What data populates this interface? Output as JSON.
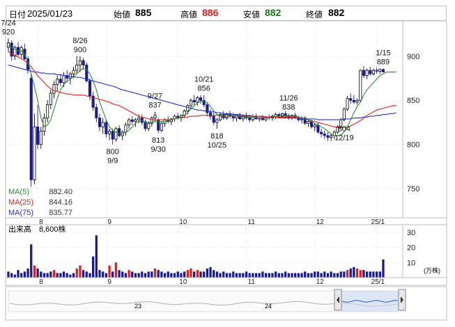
{
  "header": {
    "date_label": "日付",
    "date": "2025/01/23",
    "open_label": "始値",
    "open": "885",
    "high_label": "高値",
    "high": "886",
    "low_label": "安値",
    "low": "882",
    "close_label": "終値",
    "close": "882"
  },
  "colors": {
    "up": "#000000",
    "down": "#1a1a8c",
    "ma5": "#2e8b2e",
    "ma25": "#e02020",
    "ma75": "#2030c8",
    "volume_normal": "#1a1a8c",
    "volume_high": "#e02020",
    "high_text": "#e02020",
    "low_text": "#1a7a1a"
  },
  "chart_data": [
    {
      "type": "candlestick",
      "y_axis": {
        "range": [
          717,
          940
        ],
        "ticks": [
          "900",
          "850",
          "800",
          "750"
        ]
      },
      "x_axis": {
        "ticks": [
          "8",
          "9",
          "10",
          "11",
          "12",
          "25/1"
        ]
      },
      "legend": [
        {
          "label": "MA(5)",
          "value": "882.40"
        },
        {
          "label": "MA(25)",
          "value": "844.16"
        },
        {
          "label": "MA(75)",
          "value": "835.77"
        }
      ],
      "annotations": [
        {
          "date": "7/24",
          "price": "920",
          "idx": 0
        },
        {
          "date": "8/26",
          "price": "900",
          "idx": 22
        },
        {
          "date": "9/9",
          "price": "800",
          "idx": 32
        },
        {
          "date": "9/27",
          "price": "837",
          "idx": 45
        },
        {
          "date": "9/30",
          "price": "813",
          "idx": 46
        },
        {
          "date": "10/21",
          "price": "856",
          "idx": 60
        },
        {
          "date": "10/25",
          "price": "818",
          "idx": 64
        },
        {
          "date": "11/26",
          "price": "838",
          "idx": 86
        },
        {
          "date": "12/19",
          "price": "804",
          "idx": 103
        },
        {
          "date": "1/15",
          "price": "889",
          "idx": 115
        }
      ],
      "ohlc": [
        [
          910,
          920,
          905,
          915
        ],
        [
          915,
          918,
          895,
          900
        ],
        [
          900,
          912,
          896,
          910
        ],
        [
          910,
          916,
          900,
          902
        ],
        [
          902,
          912,
          898,
          910
        ],
        [
          908,
          914,
          895,
          897
        ],
        [
          897,
          900,
          880,
          885
        ],
        [
          875,
          880,
          745,
          760
        ],
        [
          760,
          835,
          755,
          820
        ],
        [
          820,
          845,
          795,
          800
        ],
        [
          800,
          820,
          795,
          815
        ],
        [
          815,
          835,
          810,
          830
        ],
        [
          830,
          850,
          825,
          845
        ],
        [
          845,
          862,
          840,
          858
        ],
        [
          858,
          872,
          852,
          868
        ],
        [
          868,
          878,
          860,
          874
        ],
        [
          874,
          880,
          866,
          870
        ],
        [
          870,
          882,
          865,
          878
        ],
        [
          878,
          884,
          870,
          875
        ],
        [
          875,
          882,
          868,
          880
        ],
        [
          880,
          888,
          875,
          884
        ],
        [
          884,
          900,
          880,
          890
        ],
        [
          890,
          900,
          882,
          895
        ],
        [
          895,
          898,
          885,
          890
        ],
        [
          890,
          893,
          870,
          872
        ],
        [
          872,
          875,
          850,
          855
        ],
        [
          855,
          860,
          838,
          842
        ],
        [
          842,
          846,
          825,
          830
        ],
        [
          830,
          835,
          815,
          820
        ],
        [
          820,
          830,
          812,
          825
        ],
        [
          825,
          828,
          808,
          812
        ],
        [
          812,
          818,
          805,
          815
        ],
        [
          815,
          818,
          800,
          806
        ],
        [
          806,
          820,
          803,
          818
        ],
        [
          818,
          822,
          808,
          810
        ],
        [
          810,
          816,
          805,
          814
        ],
        [
          814,
          825,
          810,
          822
        ],
        [
          822,
          830,
          818,
          828
        ],
        [
          828,
          832,
          822,
          826
        ],
        [
          826,
          830,
          820,
          828
        ],
        [
          828,
          834,
          824,
          830
        ],
        [
          830,
          834,
          822,
          825
        ],
        [
          825,
          828,
          815,
          818
        ],
        [
          818,
          826,
          815,
          824
        ],
        [
          824,
          832,
          820,
          830
        ],
        [
          830,
          837,
          826,
          833
        ],
        [
          828,
          830,
          813,
          816
        ],
        [
          816,
          826,
          814,
          824
        ],
        [
          824,
          830,
          820,
          828
        ],
        [
          828,
          832,
          824,
          826
        ],
        [
          826,
          830,
          822,
          829
        ],
        [
          829,
          834,
          826,
          832
        ],
        [
          832,
          836,
          828,
          830
        ],
        [
          830,
          834,
          826,
          833
        ],
        [
          833,
          840,
          830,
          838
        ],
        [
          838,
          846,
          834,
          844
        ],
        [
          844,
          852,
          840,
          850
        ],
        [
          850,
          856,
          844,
          848
        ],
        [
          848,
          855,
          844,
          853
        ],
        [
          853,
          856,
          846,
          850
        ],
        [
          850,
          856,
          842,
          845
        ],
        [
          845,
          848,
          832,
          836
        ],
        [
          836,
          840,
          828,
          832
        ],
        [
          832,
          836,
          822,
          825
        ],
        [
          825,
          830,
          818,
          828
        ],
        [
          828,
          836,
          826,
          834
        ],
        [
          834,
          838,
          828,
          830
        ],
        [
          830,
          836,
          828,
          834
        ],
        [
          834,
          838,
          830,
          832
        ],
        [
          832,
          836,
          826,
          830
        ],
        [
          830,
          834,
          826,
          833
        ],
        [
          833,
          836,
          828,
          829
        ],
        [
          829,
          834,
          826,
          832
        ],
        [
          832,
          836,
          828,
          830
        ],
        [
          830,
          833,
          825,
          828
        ],
        [
          828,
          834,
          826,
          832
        ],
        [
          832,
          835,
          828,
          829
        ],
        [
          829,
          832,
          826,
          830
        ],
        [
          830,
          833,
          827,
          828
        ],
        [
          828,
          832,
          826,
          831
        ],
        [
          831,
          834,
          828,
          830
        ],
        [
          830,
          834,
          827,
          832
        ],
        [
          832,
          836,
          829,
          834
        ],
        [
          834,
          836,
          830,
          832
        ],
        [
          832,
          836,
          830,
          835
        ],
        [
          835,
          838,
          830,
          832
        ],
        [
          832,
          835,
          828,
          830
        ],
        [
          830,
          834,
          828,
          833
        ],
        [
          833,
          836,
          829,
          830
        ],
        [
          830,
          833,
          826,
          828
        ],
        [
          828,
          832,
          824,
          830
        ],
        [
          830,
          832,
          822,
          824
        ],
        [
          824,
          828,
          820,
          826
        ],
        [
          826,
          828,
          818,
          820
        ],
        [
          820,
          824,
          815,
          822
        ],
        [
          822,
          825,
          812,
          814
        ],
        [
          814,
          818,
          808,
          812
        ],
        [
          812,
          816,
          806,
          810
        ],
        [
          810,
          814,
          804,
          808
        ],
        [
          808,
          812,
          804,
          810
        ],
        [
          810,
          816,
          806,
          814
        ],
        [
          814,
          822,
          812,
          820
        ],
        [
          820,
          830,
          818,
          828
        ],
        [
          828,
          842,
          826,
          840
        ],
        [
          840,
          855,
          838,
          852
        ],
        [
          852,
          858,
          846,
          850
        ],
        [
          850,
          856,
          846,
          848
        ],
        [
          848,
          852,
          845,
          850
        ],
        [
          850,
          885,
          848,
          884
        ],
        [
          884,
          889,
          875,
          878
        ],
        [
          878,
          886,
          874,
          884
        ],
        [
          884,
          888,
          878,
          880
        ],
        [
          880,
          886,
          878,
          884
        ],
        [
          884,
          887,
          880,
          883
        ],
        [
          883,
          886,
          880,
          885
        ],
        [
          885,
          886,
          882,
          882
        ]
      ],
      "ma5": [
        912,
        910,
        908,
        906,
        906,
        902,
        894,
        880,
        866,
        850,
        830,
        820,
        822,
        828,
        840,
        852,
        862,
        868,
        872,
        874,
        877,
        880,
        884,
        886,
        885,
        880,
        872,
        862,
        848,
        838,
        828,
        820,
        816,
        814,
        812,
        812,
        814,
        816,
        820,
        824,
        826,
        827,
        826,
        825,
        825,
        826,
        826,
        826,
        826,
        827,
        828,
        829,
        830,
        831,
        833,
        836,
        840,
        844,
        847,
        849,
        849,
        847,
        843,
        838,
        834,
        832,
        831,
        831,
        832,
        832,
        832,
        832,
        831,
        831,
        831,
        831,
        830,
        830,
        830,
        830,
        830,
        831,
        832,
        832,
        833,
        833,
        833,
        832,
        832,
        831,
        830,
        829,
        828,
        826,
        824,
        822,
        820,
        818,
        815,
        812,
        810,
        810,
        811,
        814,
        820,
        828,
        836,
        843,
        848,
        856,
        862,
        866,
        870,
        874,
        878,
        880,
        882,
        882,
        882,
        882
      ],
      "ma25": [
        905,
        903,
        901,
        899,
        897,
        895,
        892,
        888,
        883,
        878,
        874,
        870,
        866,
        863,
        861,
        860,
        859,
        858,
        857,
        857,
        856,
        856,
        856,
        856,
        855,
        854,
        853,
        852,
        851,
        850,
        849,
        848,
        846,
        845,
        844,
        842,
        840,
        838,
        836,
        834,
        832,
        831,
        830,
        829,
        828,
        828,
        828,
        828,
        828,
        828,
        828,
        829,
        830,
        830,
        831,
        831,
        832,
        832,
        832,
        833,
        833,
        833,
        833,
        833,
        833,
        833,
        833,
        833,
        833,
        833,
        833,
        833,
        833,
        832,
        832,
        832,
        832,
        832,
        831,
        831,
        831,
        831,
        831,
        831,
        831,
        831,
        831,
        831,
        831,
        830,
        830,
        829,
        828,
        827,
        826,
        825,
        824,
        823,
        822,
        821,
        820,
        819,
        819,
        819,
        820,
        821,
        823,
        825,
        827,
        830,
        833,
        835,
        837,
        839,
        840,
        841,
        842,
        843,
        844,
        844
      ],
      "ma75": [
        890,
        889,
        888,
        887,
        886,
        885,
        884,
        883,
        882,
        882,
        881,
        881,
        880,
        880,
        880,
        879,
        879,
        878,
        878,
        877,
        877,
        876,
        876,
        875,
        874,
        873,
        872,
        871,
        870,
        869,
        868,
        867,
        866,
        865,
        863,
        862,
        861,
        860,
        859,
        858,
        857,
        856,
        855,
        854,
        853,
        852,
        851,
        850,
        849,
        848,
        847,
        846,
        845,
        844,
        843,
        842,
        841,
        840,
        839,
        839,
        838,
        838,
        837,
        837,
        836,
        836,
        835,
        835,
        835,
        834,
        834,
        834,
        833,
        833,
        833,
        832,
        832,
        832,
        832,
        831,
        831,
        831,
        831,
        830,
        830,
        830,
        830,
        830,
        830,
        830,
        829,
        829,
        829,
        829,
        829,
        828,
        828,
        828,
        828,
        828,
        828,
        828,
        828,
        829,
        829,
        829,
        830,
        830,
        830,
        831,
        831,
        832,
        832,
        833,
        833,
        834,
        834,
        835,
        835,
        836
      ]
    },
    {
      "type": "bar",
      "title": "出来高",
      "latest_label": "8,600株",
      "unit": "(万株)",
      "y_axis": {
        "range": [
          0,
          35
        ],
        "ticks": [
          "30",
          "20",
          "10"
        ]
      },
      "values": [
        4,
        3,
        2,
        5,
        3,
        4,
        6,
        22,
        8,
        6,
        4,
        3,
        3,
        4,
        5,
        3,
        3,
        4,
        3,
        2,
        3,
        6,
        8,
        5,
        4,
        3,
        14,
        28,
        5,
        4,
        3,
        8,
        4,
        10,
        5,
        4,
        3,
        5,
        4,
        3,
        3,
        4,
        3,
        4,
        4,
        6,
        5,
        4,
        3,
        4,
        3,
        3,
        4,
        3,
        4,
        5,
        6,
        4,
        5,
        4,
        4,
        6,
        7,
        5,
        4,
        3,
        4,
        3,
        3,
        4,
        3,
        3,
        3,
        4,
        3,
        3,
        3,
        3,
        4,
        3,
        3,
        3,
        4,
        3,
        3,
        4,
        3,
        3,
        3,
        3,
        3,
        4,
        3,
        3,
        4,
        4,
        3,
        4,
        3,
        4,
        3,
        3,
        4,
        4,
        5,
        6,
        7,
        6,
        5,
        5,
        4,
        4,
        4,
        4,
        4,
        12,
        5,
        4,
        4,
        4,
        3,
        3
      ]
    }
  ],
  "navigator": {
    "labels": [
      "23",
      "24"
    ]
  }
}
